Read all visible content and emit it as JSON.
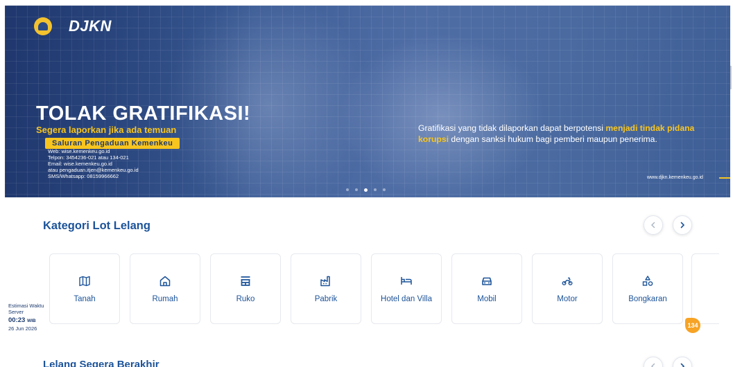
{
  "banner": {
    "logo_text": "DJKN",
    "headline": "TOLAK GRATIFIKASI!",
    "subhead": "Segera laporkan jika ada temuan",
    "pill": "Saluran Pengaduan Kemenkeu",
    "contact": [
      "Web: wise.kemenkeu.go.id",
      "Telpon: 3454236-021 atau 134-021",
      "Email: wise.kemenkeu.go.id",
      "atau pengaduan.itjen@kemenkeu.go.id",
      "SMS/Whatsapp: 08159966662"
    ],
    "right_text_1": "Gratifikasi yang tidak dilaporkan dapat berpotensi ",
    "right_text_hl": "menjadi tindak pidana korupsi",
    "right_text_2": " dengan sanksi hukum bagi pemberi maupun penerima.",
    "website": "www.djkn.kemenkeu.go.id",
    "slide_count": 5,
    "active_slide": 3
  },
  "categories": {
    "title": "Kategori Lot Lelang",
    "prev_icon": "chevron-left-icon",
    "next_icon": "chevron-right-icon",
    "items": [
      {
        "label": "Tanah",
        "icon": "map-icon"
      },
      {
        "label": "Rumah",
        "icon": "home-icon"
      },
      {
        "label": "Ruko",
        "icon": "store-icon"
      },
      {
        "label": "Pabrik",
        "icon": "factory-icon"
      },
      {
        "label": "Hotel dan Villa",
        "icon": "bed-icon"
      },
      {
        "label": "Mobil",
        "icon": "car-icon"
      },
      {
        "label": "Motor",
        "icon": "motorcycle-icon"
      },
      {
        "label": "Bongkaran",
        "icon": "shapes-icon"
      }
    ]
  },
  "server_time": {
    "label": "Estimasi Waktu Server",
    "time": "00:23",
    "timezone": "WIB",
    "date": "26 Jun 2026"
  },
  "chat_badge": "134",
  "ending_soon": {
    "title": "Lelang Segera Berakhir"
  },
  "colors": {
    "brand_blue": "#1c5399",
    "accent_yellow": "#f8c51f",
    "badge_orange": "#f7a325"
  }
}
